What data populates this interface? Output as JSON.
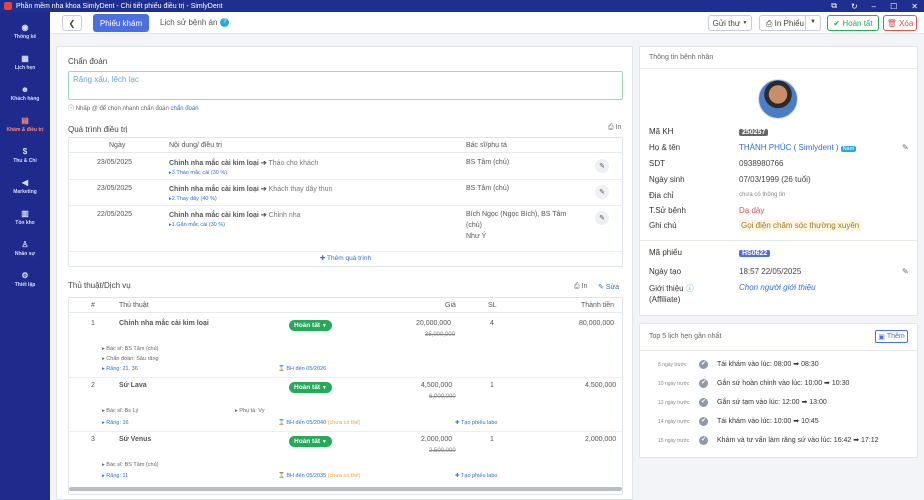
{
  "window": {
    "title": "Phần mềm nha khoa SimlyDent - Chi tiết phiếu điều trị - SimlyDent"
  },
  "sidebar": {
    "items": [
      {
        "label": "Thống kê",
        "icon": "dashboard-icon"
      },
      {
        "label": "Lịch hẹn",
        "icon": "calendar-icon"
      },
      {
        "label": "Khách hàng",
        "icon": "users-icon"
      },
      {
        "label": "Khám & điều trị",
        "icon": "clipboard-icon"
      },
      {
        "label": "Thu & Chi",
        "icon": "dollar-icon"
      },
      {
        "label": "Marketing",
        "icon": "megaphone-icon"
      },
      {
        "label": "Tồn kho",
        "icon": "warehouse-icon"
      },
      {
        "label": "Nhân sự",
        "icon": "person-icon"
      },
      {
        "label": "Thiết lập",
        "icon": "settings-icon"
      }
    ],
    "active_index": 3
  },
  "header": {
    "tab_kham": "Phiếu khám",
    "tab_lichsu": "Lịch sử bệnh án",
    "lichsu_badge": "?",
    "btn_gui": "Gửi thư",
    "btn_in": "In Phiếu",
    "btn_hoantat": "Hoàn tất",
    "btn_xoa": "Xóa"
  },
  "diagnosis": {
    "title": "Chẩn đoán",
    "value": "Răng xấu, lệch lạc",
    "hint_prefix": "Nhấp @ để chọn nhanh chẩn đoán",
    "hint_link": "chẩn đoán"
  },
  "process": {
    "title": "Quá trình điều trị",
    "print": "In",
    "headers": {
      "date": "Ngày",
      "content": "Nội dung/ điều trị",
      "doctor": "Bác sĩ/phụ tá"
    },
    "rows": [
      {
        "date": "23/05/2025",
        "service": "Chỉnh nha mắc cài kim loại",
        "action": "Tháo cho khách",
        "step": "3.Tháo mắc cài (30 %)",
        "doctor": "BS Tâm (chủ)",
        "doctor2": "",
        "doctor3": ""
      },
      {
        "date": "23/05/2025",
        "service": "Chỉnh nha mắc cài kim loại",
        "action": "Khách thay dây thun",
        "step": "2.Thay dây (40 %)",
        "doctor": "BS Tâm (chủ)",
        "doctor2": "",
        "doctor3": ""
      },
      {
        "date": "22/05/2025",
        "service": "Chỉnh nha mắc cài kim loại",
        "action": "Chỉnh nha",
        "step": "1.Gắn mắc cài (30 %)",
        "doctor": "Bích Ngọc (Ngọc Bích), BS Tâm",
        "doctor2": "(chủ)",
        "doctor3": "Như Ý"
      }
    ],
    "add_label": "Thêm quá trình"
  },
  "services": {
    "title": "Thủ thuật/Dịch vụ",
    "print": "In",
    "edit": "Sửa",
    "headers": {
      "num": "#",
      "name": "Thủ thuật",
      "price": "Giá",
      "qty": "SL",
      "total": "Thành tiền"
    },
    "rows": [
      {
        "num": "1",
        "name": "Chỉnh nha mắc cài kim loại",
        "status": "Hoàn tất",
        "price": "20,000,000",
        "old_price": "35,000,000",
        "qty": "4",
        "total": "80,000,000",
        "doctor": "Bác sĩ: BS Tâm (chủ)",
        "diag": "Chẩn đoán: Sâu răng",
        "teeth": "Răng: 21, 36",
        "warranty": "BH đến 05/2026",
        "warranty_note": "",
        "assistant": "",
        "labo": ""
      },
      {
        "num": "2",
        "name": "Sứ Lava",
        "status": "Hoàn tất",
        "price": "4,500,000",
        "old_price": "6,000,000",
        "qty": "1",
        "total": "4,500,000",
        "doctor": "Bác sĩ: Bs Lý",
        "diag": "",
        "teeth": "Răng: 16",
        "warranty": "BH đến 05/2040",
        "warranty_note": "(chưa có thẻ)",
        "assistant": "Phụ tá: Vy",
        "labo": "Tạo phiếu labo"
      },
      {
        "num": "3",
        "name": "Sứ Venus",
        "status": "Hoàn tất",
        "price": "2,000,000",
        "old_price": "2,500,000",
        "qty": "1",
        "total": "2,000,000",
        "doctor": "Bác sĩ: BS Tâm (chủ)",
        "diag": "",
        "teeth": "Răng: 11",
        "warranty": "BH đến 05/2035",
        "warranty_note": "(chưa có thẻ)",
        "assistant": "",
        "labo": "Tạo phiếu labo"
      }
    ]
  },
  "patient": {
    "title": "Thông tin bệnh nhân",
    "labels": {
      "ma_kh": "Mã KH",
      "ho_ten": "Họ & tên",
      "sdt": "SDT",
      "ngay_sinh": "Ngày sinh",
      "dia_chi": "Địa chỉ",
      "ts_benh": "T.Sử bệnh",
      "ghi_chu": "Ghi chú",
      "ma_phieu": "Mã phiếu",
      "ngay_tao": "Ngày tạo",
      "gioi_thieu": "Giới thiệu",
      "affiliate": "(Affiliate)"
    },
    "ma_kh": "250257",
    "ho_ten": "THÀNH PHÚC ( Simlydent )",
    "gender": "Nam",
    "sdt": "0938980766",
    "ngay_sinh": "07/03/1999 (26 tuổi)",
    "dia_chi": "chưa có thông tin",
    "ts_benh": "Dạ dày",
    "ghi_chu": "Gọi điện chăm sóc thường xuyên",
    "ma_phieu": "HS0622",
    "ngay_tao": "18:57 22/05/2025",
    "gioi_thieu": "Chọn người giới thiệu"
  },
  "appointments": {
    "title": "Top 5 lịch hẹn gần nhất",
    "add": "Thêm",
    "rows": [
      {
        "ago": "8 ngày trước",
        "text": "Tái khám vào lúc: 08:00 ➡ 08:30"
      },
      {
        "ago": "10 ngày trước",
        "text": "Gắn sứ hoàn chỉnh vào lúc: 10:00 ➡ 10:30"
      },
      {
        "ago": "13 ngày trước",
        "text": "Gắn sứ tạm vào lúc: 12:00 ➡ 13:00"
      },
      {
        "ago": "14 ngày trước",
        "text": "Tái khám vào lúc: 10:00 ➡ 10:45"
      },
      {
        "ago": "15 ngày trước",
        "text": "Khám và tư vấn làm răng sứ vào lúc: 16:42 ➡ 17:12"
      }
    ]
  },
  "colors": {
    "sidebar": "#1e2a8c",
    "accent": "#4c6fe0",
    "success": "#27a85a",
    "danger": "#d9534f"
  }
}
